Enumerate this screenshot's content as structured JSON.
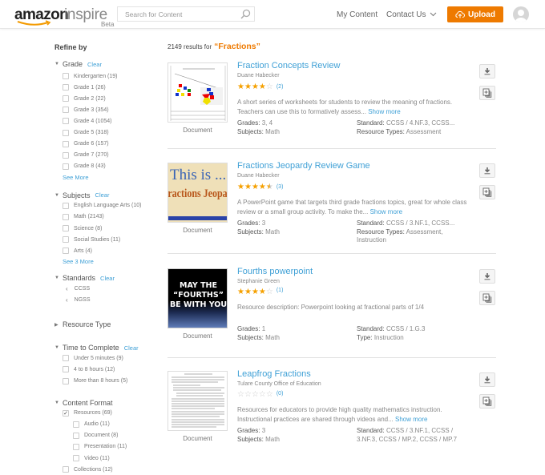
{
  "header": {
    "logo_amazon": "amazon",
    "logo_inspire": "inspire",
    "logo_beta": "Beta",
    "search_placeholder": "Search for Content",
    "my_content": "My Content",
    "contact_us": "Contact Us",
    "upload": "Upload",
    "brand_color": "#ee7a00",
    "link_color": "#3fa0d6"
  },
  "sidebar": {
    "title": "Refine by",
    "grade": {
      "label": "Grade",
      "clear": "Clear",
      "options": [
        "Kindergarten (19)",
        "Grade 1 (26)",
        "Grade 2 (22)",
        "Grade 3 (354)",
        "Grade 4 (1054)",
        "Grade 5 (318)",
        "Grade 6 (157)",
        "Grade 7 (270)",
        "Grade 8 (43)"
      ],
      "see_more": "See More"
    },
    "subjects": {
      "label": "Subjects",
      "clear": "Clear",
      "options": [
        "English Language Arts (10)",
        "Math (2143)",
        "Science (8)",
        "Social Studies (11)",
        "Arts (4)"
      ],
      "see_more": "See 3 More"
    },
    "standards": {
      "label": "Standards",
      "clear": "Clear",
      "options": [
        "CCSS",
        "NGSS"
      ]
    },
    "resource_type": {
      "label": "Resource Type"
    },
    "time": {
      "label": "Time to Complete",
      "clear": "Clear",
      "options": [
        "Under 5 minutes (9)",
        "4 to 8 hours (12)",
        "More than 8 hours (5)"
      ]
    },
    "format": {
      "label": "Content Format",
      "resources": "Resources (69)",
      "resources_checked": true,
      "sub_options": [
        "Audio (11)",
        "Document (8)",
        "Presentation (11)",
        "Video (11)"
      ],
      "collections": "Collections (12)"
    }
  },
  "results": {
    "count_text": "2149 results for",
    "query": "“Fractions”",
    "items": [
      {
        "title": "Fraction Concepts Review",
        "author": "Duane Habecker",
        "rating": 4,
        "rating_count": "(2)",
        "desc": "A short series of worksheets for students to review the meaning of fractions. Teachers can use this to formatively assess...",
        "show_more": "Show more",
        "type_label": "Document",
        "grades_label": "Grades:",
        "grades": "3, 4",
        "subjects_label": "Subjects:",
        "subjects": "Math",
        "standard_label": "Standard:",
        "standard": "CCSS / 4.NF.3, CCSS...",
        "rtype_label": "Resource Types:",
        "rtype": "Assessment"
      },
      {
        "title": "Fractions Jeopardy Review Game",
        "author": "Duane Habecker",
        "rating": 4.5,
        "rating_count": "(3)",
        "desc": "A PowerPoint game that targets third grade fractions topics, great for whole class review or a small group activity. To make the...",
        "show_more": "Show more",
        "type_label": "Document",
        "thumb_line1": "This is ...",
        "thumb_line2": "Fractions Jeopardy",
        "grades_label": "Grades:",
        "grades": "3",
        "subjects_label": "Subjects:",
        "subjects": "Math",
        "standard_label": "Standard:",
        "standard": "CCSS / 3.NF.1, CCSS...",
        "rtype_label": "Resource Types:",
        "rtype": "Assessment, Instruction"
      },
      {
        "title": "Fourths powerpoint",
        "author": "Stephanie Green",
        "rating": 4,
        "rating_count": "(1)",
        "desc": "Resource description: Powerpoint looking at fractional parts of 1/4",
        "type_label": "Document",
        "thumb_line1": "MAY THE",
        "thumb_line2": "“FOURTHS”",
        "thumb_line3": "BE WITH YOU",
        "grades_label": "Grades:",
        "grades": "1",
        "subjects_label": "Subjects:",
        "subjects": "Math",
        "standard_label": "Standard:",
        "standard": "CCSS / 1.G.3",
        "rtype_label": "Type:",
        "rtype": "Instruction"
      },
      {
        "title": "Leapfrog Fractions",
        "author": "Tulare County Office of Education",
        "rating": 0,
        "rating_count": "(0)",
        "desc": "Resources for educators to provide high quality mathematics instruction. Instructional practices are shared through videos and...",
        "show_more": "Show more",
        "type_label": "Document",
        "grades_label": "Grades:",
        "grades": "3",
        "subjects_label": "Subjects:",
        "subjects": "Math",
        "standard_label": "Standard:",
        "standard": "CCSS / 3.NF.1, CCSS / 3.NF.3, CCSS / MP.2, CCSS / MP.7"
      }
    ]
  }
}
